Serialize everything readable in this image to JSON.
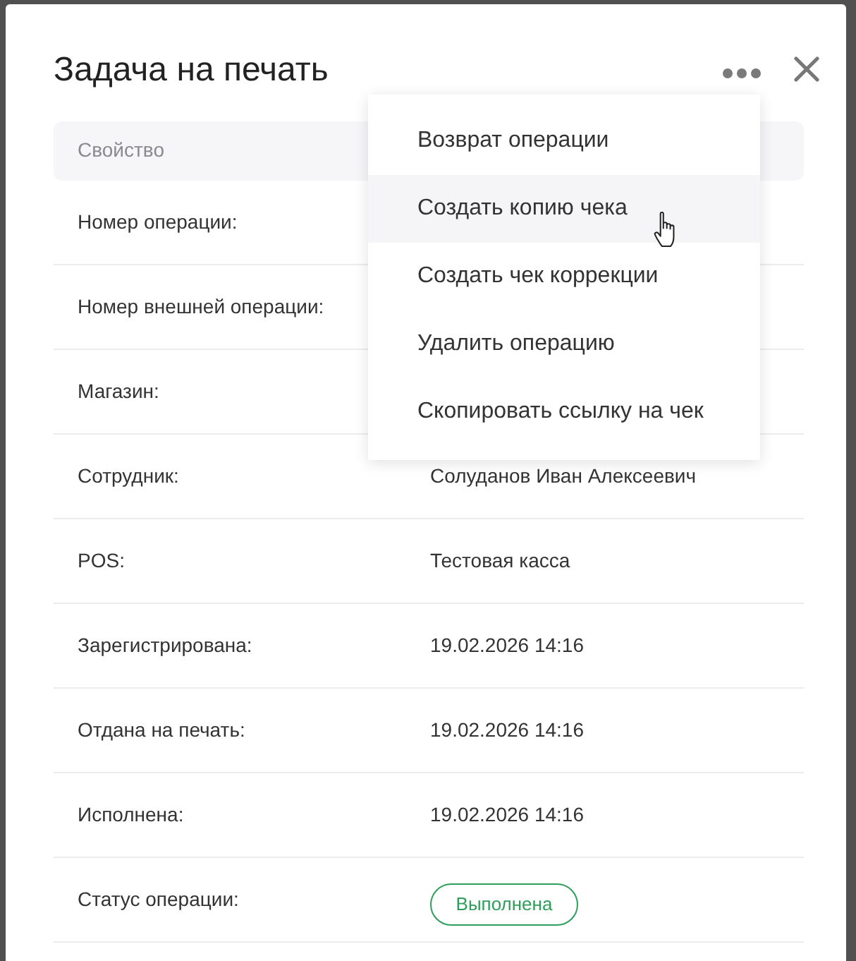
{
  "dialog": {
    "title": "Задача на печать"
  },
  "table": {
    "columns": [
      "Свойство"
    ],
    "rows": [
      {
        "label": "Номер операции:",
        "kind": "text"
      },
      {
        "label": "Номер внешней операции:",
        "kind": "text"
      },
      {
        "label": "Магазин:",
        "kind": "text"
      },
      {
        "label": "Сотрудник:",
        "kind": "text",
        "value": "Солуданов Иван Алексеевич"
      },
      {
        "label": "POS:",
        "kind": "text",
        "value": "Тестовая касса"
      },
      {
        "label": "Зарегистрирована:",
        "kind": "text",
        "value": "19.02.2026 14:16"
      },
      {
        "label": "Отдана на печать:",
        "kind": "text",
        "value": "19.02.2026 14:16"
      },
      {
        "label": "Исполнена:",
        "kind": "text",
        "value": "19.02.2026 14:16"
      },
      {
        "label": "Статус операции:",
        "kind": "status",
        "value": "Выполнена"
      }
    ]
  },
  "menu": {
    "items": [
      {
        "label": "Возврат операции",
        "hovered": false
      },
      {
        "label": "Создать копию чека",
        "hovered": true
      },
      {
        "label": "Создать чек коррекции",
        "hovered": false
      },
      {
        "label": "Удалить операцию",
        "hovered": false
      },
      {
        "label": "Скопировать ссылку на чек",
        "hovered": false
      }
    ]
  }
}
